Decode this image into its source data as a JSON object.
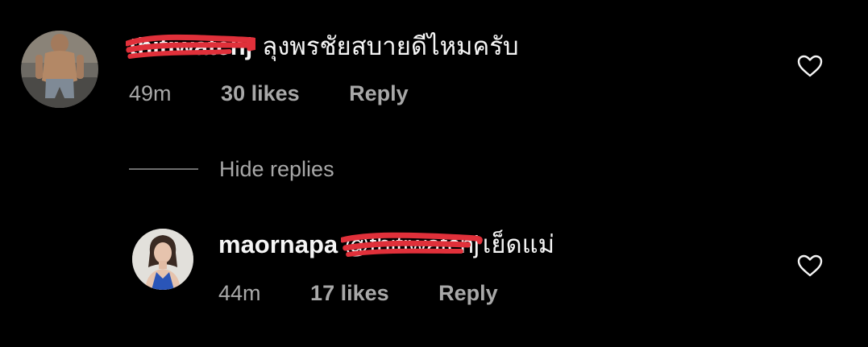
{
  "comments": [
    {
      "username_redacted": "thitiwatchj",
      "text": "ลุงพรชัยสบายดีไหมครับ",
      "time": "49m",
      "likes": "30 likes",
      "reply_label": "Reply",
      "avatar": "avatar-shirtless-man",
      "like_icon": "heart-outline-icon"
    }
  ],
  "hide_replies_label": "Hide replies",
  "replies": [
    {
      "username": "maornapa",
      "mention_redacted": "@thitiwatchj",
      "text": "เย็ดแม่",
      "time": "44m",
      "likes": "17 likes",
      "reply_label": "Reply",
      "avatar": "avatar-woman-blue-dress",
      "like_icon": "heart-outline-icon"
    }
  ],
  "colors": {
    "background": "#000000",
    "primary_text": "#f5f5f5",
    "secondary_text": "#a8a8a8",
    "redaction_scribble": "#e0303a",
    "divider": "#6e6e6e"
  }
}
